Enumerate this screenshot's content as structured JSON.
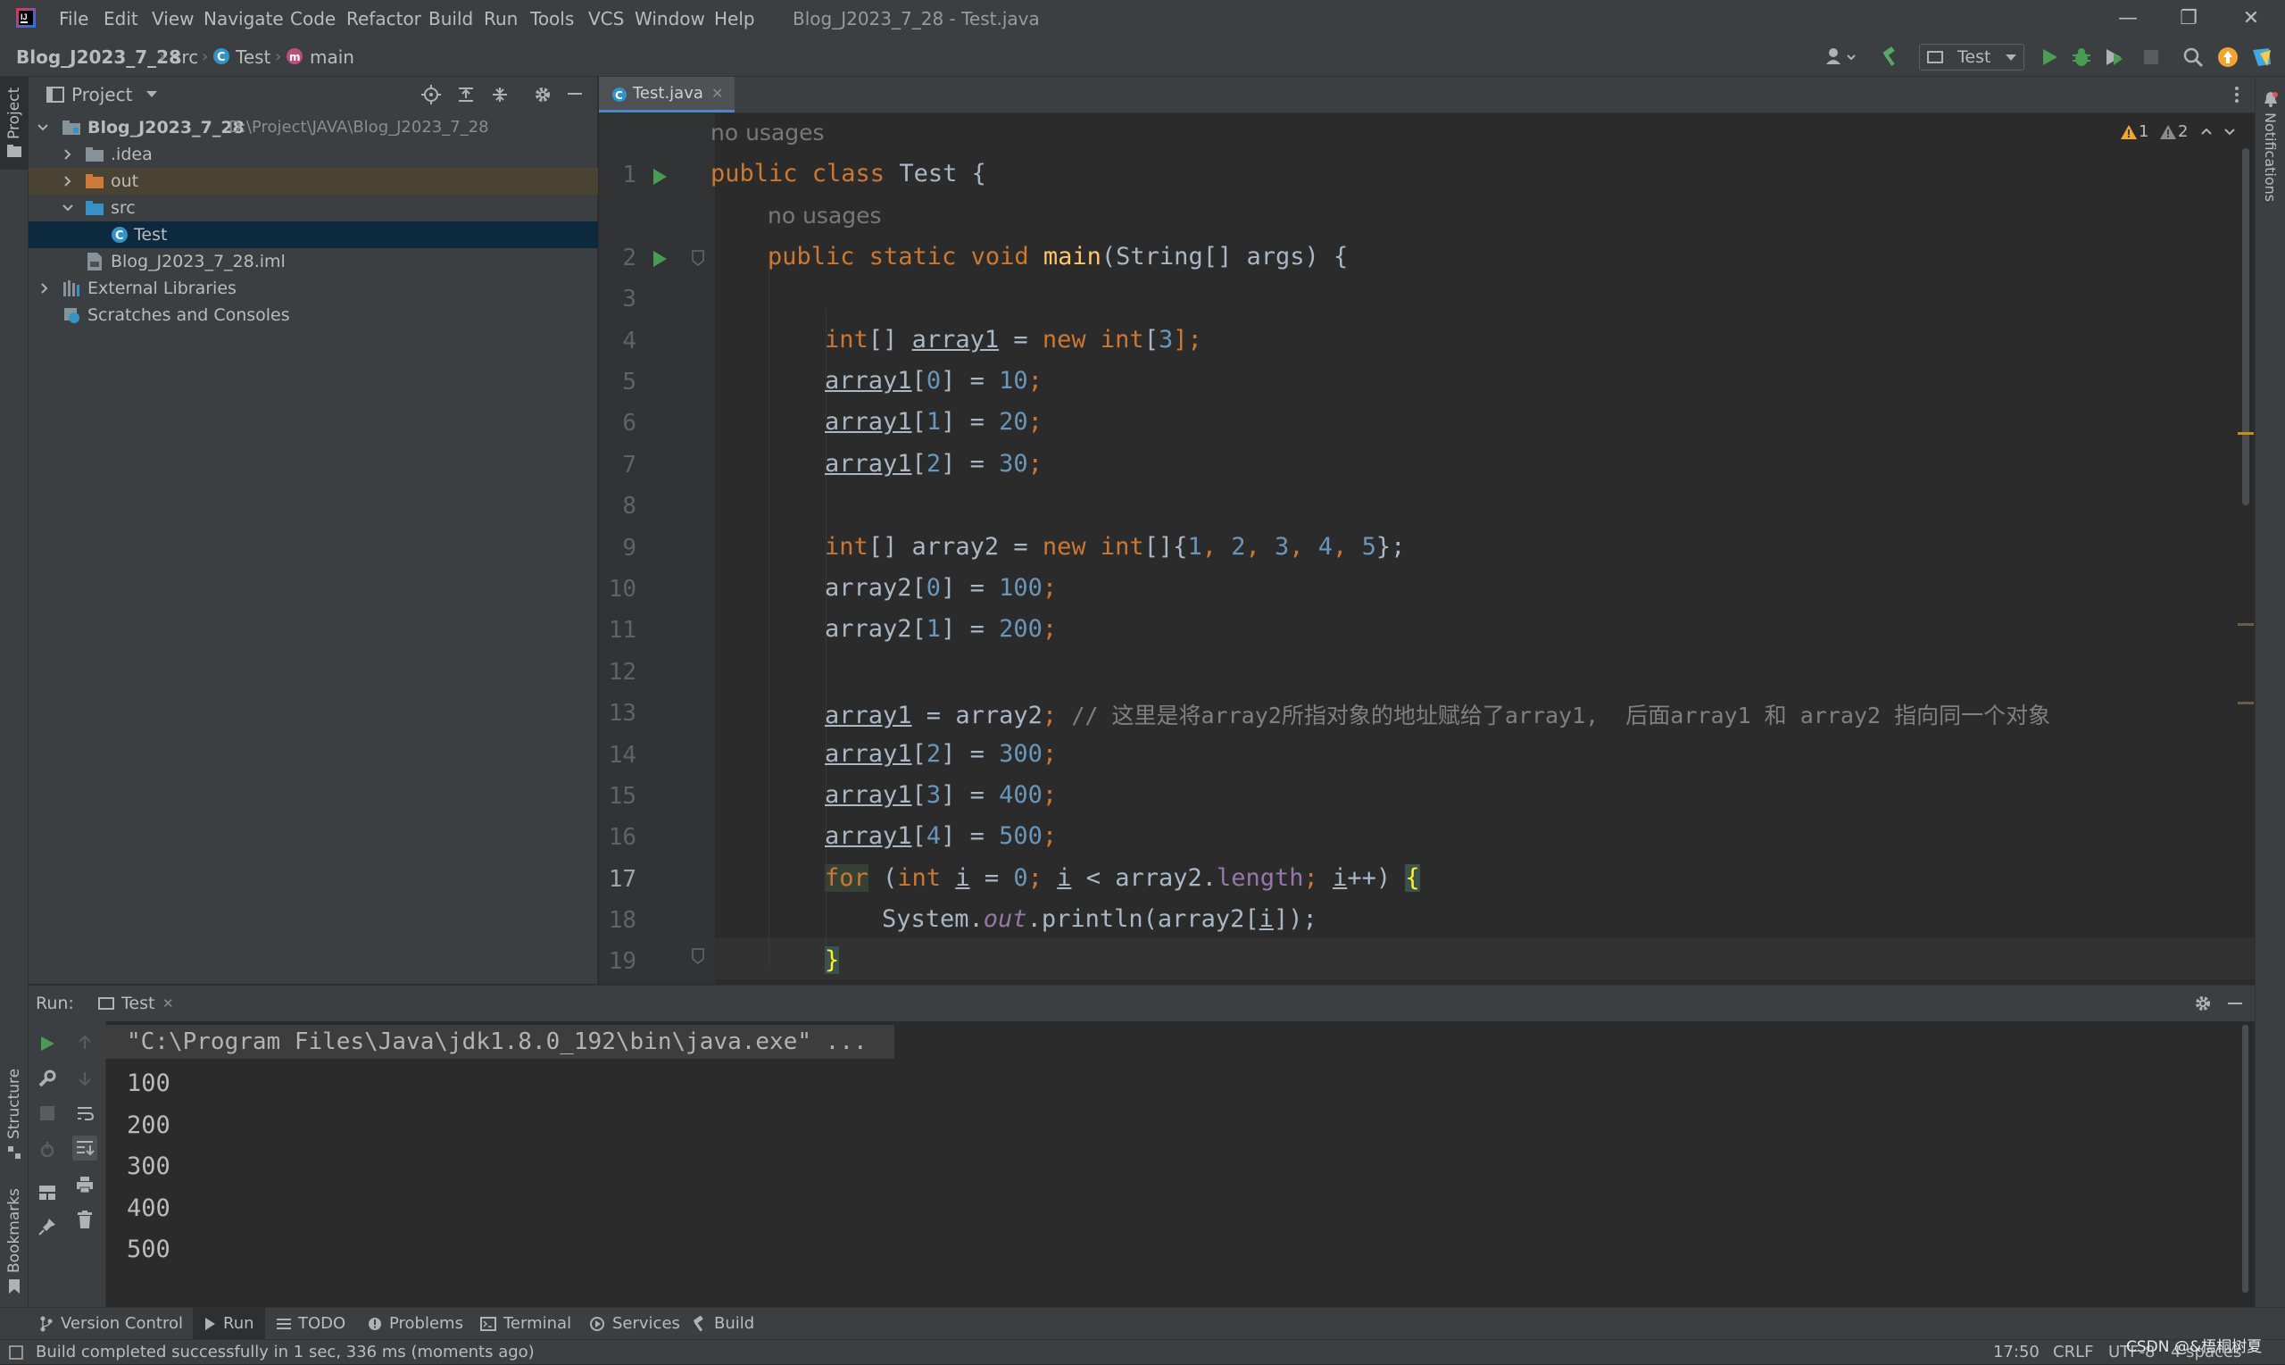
{
  "colors": {
    "bg_editor": "#2b2b2b",
    "bg_panel": "#3c3f41",
    "keyword": "#cc7832",
    "number": "#6897bb",
    "method": "#ffc66d",
    "field": "#9876aa",
    "comment": "#808080",
    "selection": "#0d293e",
    "run_green": "#499c54"
  },
  "menu": [
    "File",
    "Edit",
    "View",
    "Navigate",
    "Code",
    "Refactor",
    "Build",
    "Run",
    "Tools",
    "VCS",
    "Window",
    "Help"
  ],
  "window_title": "Blog_J2023_7_28 - Test.java",
  "breadcrumb": {
    "project": "Blog_J2023_7_28",
    "folder": "src",
    "class": "Test",
    "method": "main"
  },
  "run_config": "Test",
  "project_panel": {
    "title": "Project",
    "tree": {
      "root": "Blog_J2023_7_28",
      "root_path": "D:\\Project\\JAVA\\Blog_J2023_7_28",
      "idea": ".idea",
      "out": "out",
      "src": "src",
      "test": "Test",
      "iml": "Blog_J2023_7_28.iml",
      "ext_libs": "External Libraries",
      "scratches": "Scratches and Consoles"
    }
  },
  "editor": {
    "tab": "Test.java",
    "warnings": {
      "w1": "1",
      "w2": "2"
    },
    "hint1": "no usages",
    "hint2": "no usages",
    "line_numbers": [
      "1",
      "2",
      "3",
      "4",
      "5",
      "6",
      "7",
      "8",
      "9",
      "10",
      "11",
      "12",
      "13",
      "14",
      "15",
      "16",
      "17",
      "18",
      "19"
    ],
    "code": {
      "l1_kw": "public class",
      "l1_rest": " Test {",
      "l2_kw": "public static void",
      "l2_fn": "main",
      "l2_rest": "(String[] args) {",
      "l4_kw": "int",
      "l4_a": "[] ",
      "l4_var": "array1",
      "l4_b": " = ",
      "l4_new": "new int",
      "l4_c": "[",
      "l4_n": "3",
      "l4_d": "];",
      "l5_var": "array1",
      "l5_a": "[",
      "l5_i": "0",
      "l5_b": "] = ",
      "l5_v": "10",
      "l6_var": "array1",
      "l6_i": "1",
      "l6_v": "20",
      "l7_var": "array1",
      "l7_i": "2",
      "l7_v": "30",
      "l9_kw": "int",
      "l9_a": "[] array2 = ",
      "l9_new": "new int",
      "l9_b": "[]{",
      "l9_n1": "1",
      "l9_n2": "2",
      "l9_n3": "3",
      "l9_n4": "4",
      "l9_n5": "5",
      "l9_c": "};",
      "l10_a": "array2[",
      "l10_i": "0",
      "l10_b": "] = ",
      "l10_v": "100",
      "l11_i": "1",
      "l11_v": "200",
      "l13_var": "array1",
      "l13_a": " = array2",
      "l13_cm": "// 这里是将array2所指对象的地址赋给了array1,  后面array1 和 array2 指向同一个对象",
      "l14_var": "array1",
      "l14_i": "2",
      "l14_v": "300",
      "l15_var": "array1",
      "l15_i": "3",
      "l15_v": "400",
      "l16_var": "array1",
      "l16_i": "4",
      "l16_v": "500",
      "l17_for": "for",
      "l17_a": " (",
      "l17_int": "int",
      "l17_i": "i",
      "l17_b": " = ",
      "l17_z": "0",
      "l17_c": "; ",
      "l17_i2": "i",
      "l17_d": " < array2.",
      "l17_len": "length",
      "l17_e": "; ",
      "l17_i3": "i",
      "l17_f": "++) ",
      "l17_brace": "{",
      "l18_a": "System.",
      "l18_out": "out",
      "l18_b": ".println(array2[",
      "l18_i": "i",
      "l18_c": "]);",
      "l19_brace": "}"
    }
  },
  "run_panel": {
    "label": "Run:",
    "tab": "Test",
    "command": "\"C:\\Program Files\\Java\\jdk1.8.0_192\\bin\\java.exe\" ...",
    "output": [
      "100",
      "200",
      "300",
      "400",
      "500"
    ]
  },
  "side_labels": {
    "project": "Project",
    "structure": "Structure",
    "bookmarks": "Bookmarks",
    "notifications": "Notifications"
  },
  "bottom_tools": {
    "vcs": "Version Control",
    "run": "Run",
    "todo": "TODO",
    "problems": "Problems",
    "terminal": "Terminal",
    "services": "Services",
    "build": "Build"
  },
  "status": {
    "message": "Build completed successfully in 1 sec, 336 ms (moments ago)",
    "position": "17:50",
    "line_sep": "CRLF",
    "encoding": "UTF-8",
    "indent": "4 spaces",
    "watermark": "CSDN @&梧桐树夏"
  }
}
